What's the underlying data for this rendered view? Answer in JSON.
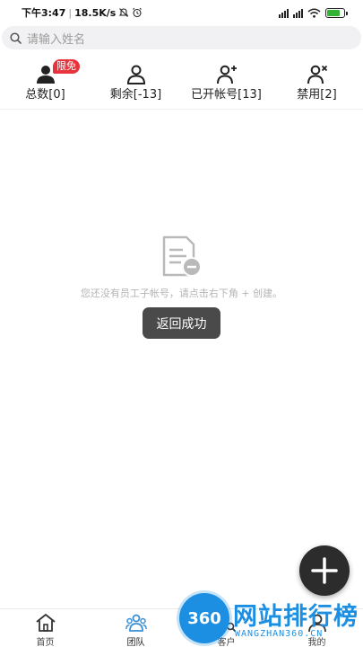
{
  "status_bar": {
    "time": "下午3:47",
    "separator": "|",
    "speed": "18.5K/s",
    "battery_color": "#34b233"
  },
  "search": {
    "placeholder": "请输入姓名",
    "icon": "search-icon"
  },
  "stats": [
    {
      "label": "总数[0]",
      "icon": "person-filled-icon",
      "badge": "限免"
    },
    {
      "label": "剩余[-13]",
      "icon": "person-outline-icon"
    },
    {
      "label": "已开帐号[13]",
      "icon": "person-add-icon"
    },
    {
      "label": "禁用[2]",
      "icon": "person-disabled-icon"
    }
  ],
  "empty_state": {
    "message": "您还没有员工子帐号，请点击右下角 + 创建。",
    "icon": "document-minus-icon"
  },
  "toast": {
    "text": "返回成功"
  },
  "fab": {
    "icon": "plus-icon"
  },
  "tabs": [
    {
      "label": "首页",
      "icon": "home-icon"
    },
    {
      "label": "团队",
      "icon": "team-icon",
      "active": true
    },
    {
      "label": "客户",
      "icon": "customer-search-icon"
    },
    {
      "label": "我的",
      "icon": "profile-icon"
    }
  ],
  "watermark": {
    "logo": "360",
    "title": "网站排行榜",
    "subtitle": "WANGZHAN360.CN"
  },
  "colors": {
    "badge": "#e8323c",
    "accent": "#1d8fe2",
    "fab": "#2c2c2c",
    "team_icon": "#3b8fd6"
  }
}
